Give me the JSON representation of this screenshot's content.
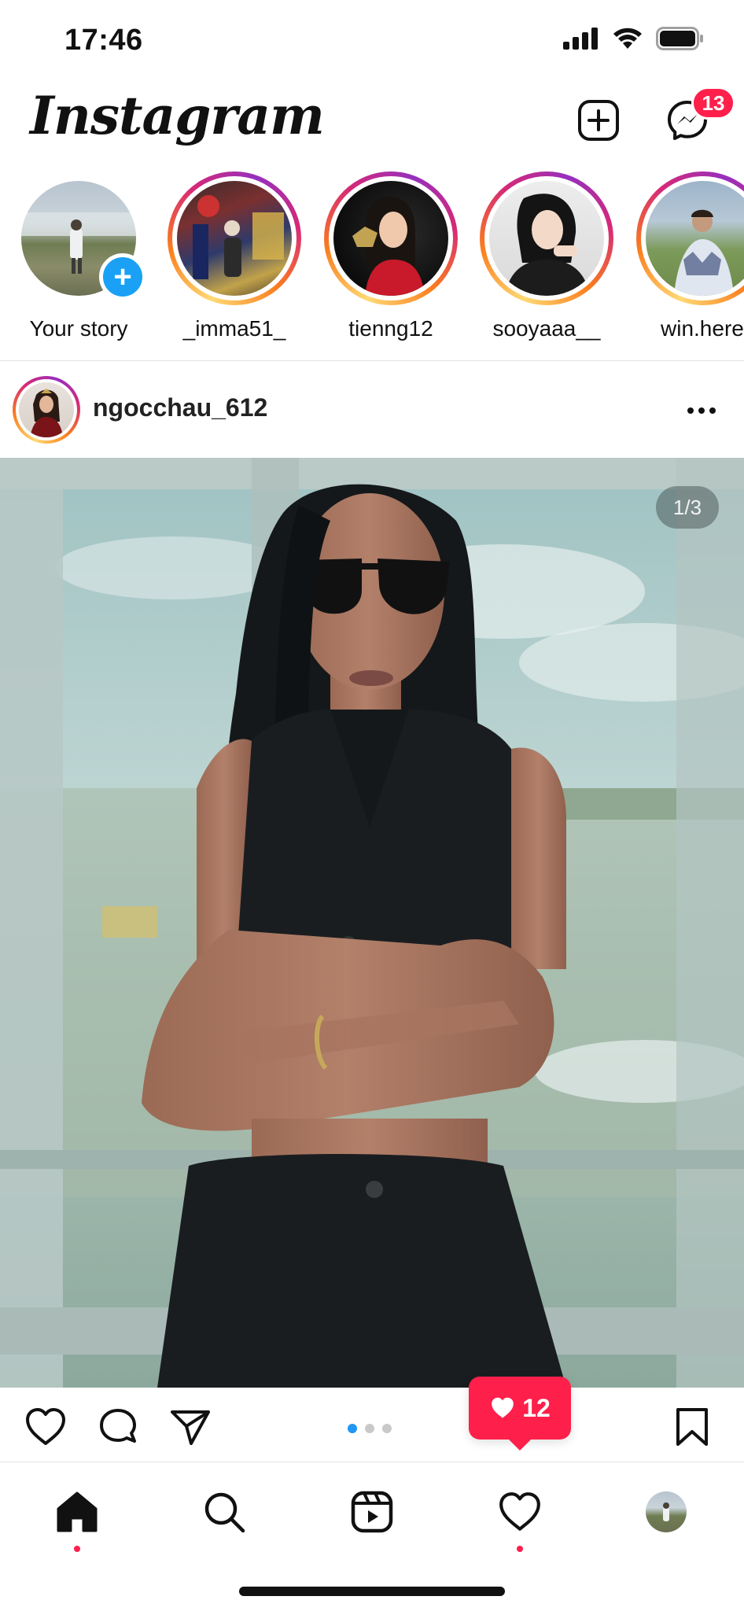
{
  "status_bar": {
    "time": "17:46",
    "icons": [
      "signal-icon",
      "wifi-icon",
      "battery-icon"
    ]
  },
  "header": {
    "logo_text": "Instagram",
    "icons": [
      "new-post-icon",
      "messenger-icon"
    ],
    "messenger_badge": "13"
  },
  "stories": [
    {
      "label": "Your story",
      "own": true,
      "icon": "add-story-plus-icon"
    },
    {
      "label": "_imma51_",
      "own": false
    },
    {
      "label": "tienng12",
      "own": false
    },
    {
      "label": "sooyaaa__",
      "own": false
    },
    {
      "label": "win.here",
      "own": false
    }
  ],
  "post": {
    "username": "ngocchau_612",
    "image_counter": "1/3",
    "carousel": {
      "count": 3,
      "active": 1
    },
    "like_notification_count": "12",
    "actions": [
      "like-icon",
      "comment-icon",
      "share-icon",
      "bookmark-icon"
    ]
  },
  "bottom_nav": {
    "items": [
      "home-icon",
      "search-icon",
      "reels-icon",
      "activity-heart-icon",
      "profile-avatar"
    ],
    "active": "home-icon"
  },
  "colors": {
    "accent_red": "#ff1f4b",
    "accent_blue": "#1aa1f5",
    "text": "#111111"
  }
}
